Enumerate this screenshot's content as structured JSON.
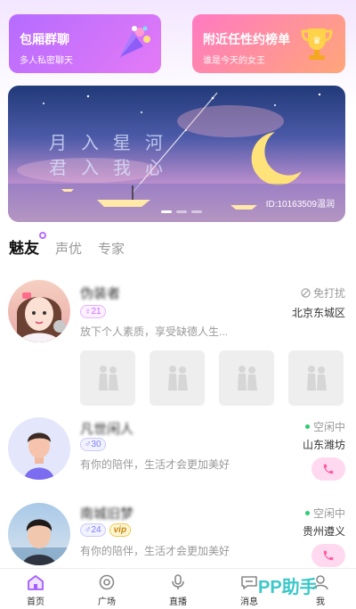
{
  "cards": [
    {
      "title": "包厢群聊",
      "subtitle": "多人私密聊天",
      "icon": "party-popper-icon"
    },
    {
      "title": "附近任性约榜单",
      "subtitle": "谁是今天的女王",
      "icon": "trophy-icon"
    }
  ],
  "banner": {
    "line1": "月入星河",
    "line2": "君入我心",
    "uid": "ID:10163509温润"
  },
  "tabs": [
    {
      "label": "魅友",
      "active": true
    },
    {
      "label": "声优",
      "active": false
    },
    {
      "label": "专家",
      "active": false
    }
  ],
  "users": [
    {
      "name": "伪装者",
      "gender_age": "♀21",
      "gender": "female",
      "bio": "放下个人素质，享受缺德人生...",
      "status": "免打扰",
      "location": "北京东城区"
    },
    {
      "name": "凡世闲人",
      "gender_age": "♂30",
      "gender": "male",
      "bio": "有你的陪伴，生活才会更加美好",
      "status": "空闲中",
      "location": "山东潍坊"
    },
    {
      "name": "南城旧梦",
      "gender_age": "♂24",
      "gender": "male",
      "vip": "vip",
      "bio": "有你的陪伴，生活才会更加美好",
      "status": "空闲中",
      "location": "贵州遵义"
    }
  ],
  "nav": [
    {
      "label": "首页",
      "icon": "home-icon",
      "active": true
    },
    {
      "label": "广场",
      "icon": "plaza-icon",
      "active": false
    },
    {
      "label": "直播",
      "icon": "microphone-icon",
      "active": false
    },
    {
      "label": "消息",
      "icon": "message-icon",
      "active": false
    },
    {
      "label": "我",
      "icon": "profile-icon",
      "active": false
    }
  ],
  "watermark": "PP助手",
  "colors": {
    "accent": "#b86bff",
    "online": "#2ecc71",
    "call": "#ff5aa5"
  }
}
